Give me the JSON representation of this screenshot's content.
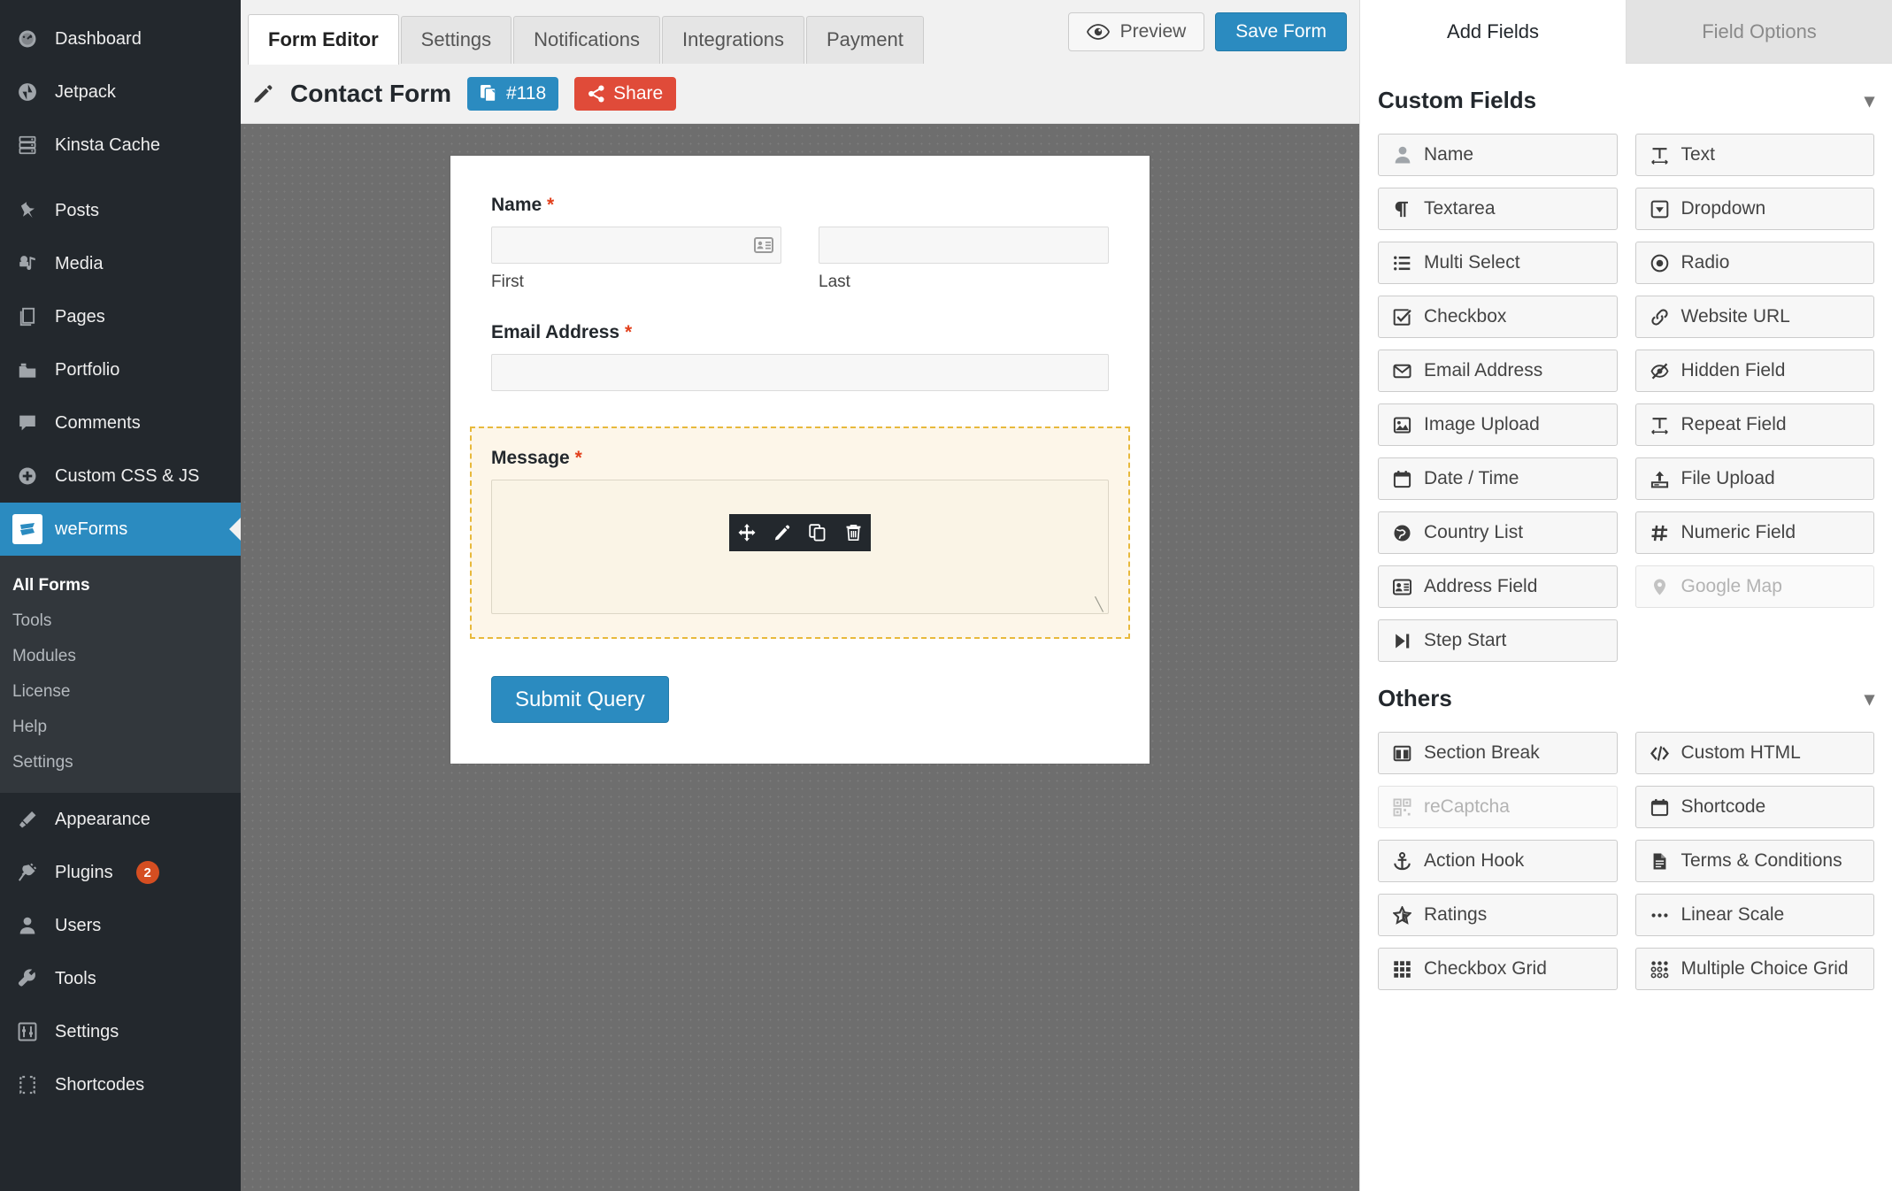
{
  "sidebar": {
    "items_top": [
      {
        "label": "Dashboard",
        "icon": "dashboard-icon"
      },
      {
        "label": "Jetpack",
        "icon": "jetpack-icon"
      },
      {
        "label": "Kinsta Cache",
        "icon": "server-icon"
      }
    ],
    "items_content": [
      {
        "label": "Posts",
        "icon": "pin-icon"
      },
      {
        "label": "Media",
        "icon": "media-icon"
      },
      {
        "label": "Pages",
        "icon": "pages-icon"
      },
      {
        "label": "Portfolio",
        "icon": "portfolio-icon"
      },
      {
        "label": "Comments",
        "icon": "comment-icon"
      },
      {
        "label": "Custom CSS & JS",
        "icon": "plus-circle-icon"
      }
    ],
    "active_item": {
      "label": "weForms",
      "icon": "weforms-logo-icon"
    },
    "submenu": [
      {
        "label": "All Forms",
        "current": true
      },
      {
        "label": "Tools",
        "current": false
      },
      {
        "label": "Modules",
        "current": false
      },
      {
        "label": "License",
        "current": false
      },
      {
        "label": "Help",
        "current": false
      },
      {
        "label": "Settings",
        "current": false
      }
    ],
    "items_bottom": [
      {
        "label": "Appearance",
        "icon": "brush-icon",
        "badge": ""
      },
      {
        "label": "Plugins",
        "icon": "plug-icon",
        "badge": "2"
      },
      {
        "label": "Users",
        "icon": "user-icon",
        "badge": ""
      },
      {
        "label": "Tools",
        "icon": "wrench-icon",
        "badge": ""
      },
      {
        "label": "Settings",
        "icon": "sliders-icon",
        "badge": ""
      },
      {
        "label": "Shortcodes",
        "icon": "brackets-icon",
        "badge": ""
      }
    ]
  },
  "tabs": [
    {
      "label": "Form Editor",
      "active": true
    },
    {
      "label": "Settings",
      "active": false
    },
    {
      "label": "Notifications",
      "active": false
    },
    {
      "label": "Integrations",
      "active": false
    },
    {
      "label": "Payment",
      "active": false
    }
  ],
  "top_actions": {
    "preview_label": "Preview",
    "save_label": "Save Form"
  },
  "title_row": {
    "form_name": "Contact Form",
    "form_id_label": "#118",
    "share_label": "Share"
  },
  "form": {
    "fields": [
      {
        "label": "Name",
        "required": "*",
        "type": "name",
        "columns": [
          {
            "sub_label": "First",
            "value": "",
            "has_autofill_icon": true
          },
          {
            "sub_label": "Last",
            "value": "",
            "has_autofill_icon": false
          }
        ]
      },
      {
        "label": "Email Address",
        "required": "*",
        "type": "email",
        "value": ""
      },
      {
        "label": "Message",
        "required": "*",
        "type": "textarea",
        "value": "",
        "highlighted": true
      }
    ],
    "submit_label": "Submit Query",
    "hover_toolbar": [
      {
        "name": "move-icon",
        "title": "Move"
      },
      {
        "name": "edit-icon",
        "title": "Edit"
      },
      {
        "name": "duplicate-icon",
        "title": "Duplicate"
      },
      {
        "name": "delete-icon",
        "title": "Delete"
      }
    ]
  },
  "right_panel": {
    "tabs": [
      {
        "label": "Add Fields",
        "active": true
      },
      {
        "label": "Field Options",
        "active": false
      }
    ],
    "sections": [
      {
        "title": "Custom Fields",
        "collapsed": false,
        "fields": [
          {
            "label": "Name",
            "icon": "user-icon",
            "disabled": false
          },
          {
            "label": "Text",
            "icon": "text-width-icon",
            "disabled": false
          },
          {
            "label": "Textarea",
            "icon": "paragraph-icon",
            "disabled": false
          },
          {
            "label": "Dropdown",
            "icon": "caret-square-down-icon",
            "disabled": false
          },
          {
            "label": "Multi Select",
            "icon": "list-ul-icon",
            "disabled": false
          },
          {
            "label": "Radio",
            "icon": "dot-circle-icon",
            "disabled": false
          },
          {
            "label": "Checkbox",
            "icon": "check-square-icon",
            "disabled": false
          },
          {
            "label": "Website URL",
            "icon": "link-icon",
            "disabled": false
          },
          {
            "label": "Email Address",
            "icon": "envelope-icon",
            "disabled": false
          },
          {
            "label": "Hidden Field",
            "icon": "eye-slash-icon",
            "disabled": false
          },
          {
            "label": "Image Upload",
            "icon": "image-icon",
            "disabled": false
          },
          {
            "label": "Repeat Field",
            "icon": "text-width-icon",
            "disabled": false
          },
          {
            "label": "Date / Time",
            "icon": "calendar-icon",
            "disabled": false
          },
          {
            "label": "File Upload",
            "icon": "upload-icon",
            "disabled": false
          },
          {
            "label": "Country List",
            "icon": "globe-icon",
            "disabled": false
          },
          {
            "label": "Numeric Field",
            "icon": "hashtag-icon",
            "disabled": false
          },
          {
            "label": "Address Field",
            "icon": "address-card-icon",
            "disabled": false
          },
          {
            "label": "Google Map",
            "icon": "map-marker-icon",
            "disabled": true
          },
          {
            "label": "Step Start",
            "icon": "step-forward-icon",
            "disabled": false
          }
        ]
      },
      {
        "title": "Others",
        "collapsed": false,
        "fields": [
          {
            "label": "Section Break",
            "icon": "columns-icon",
            "disabled": false
          },
          {
            "label": "Custom HTML",
            "icon": "code-icon",
            "disabled": false
          },
          {
            "label": "reCaptcha",
            "icon": "qrcode-icon",
            "disabled": true
          },
          {
            "label": "Shortcode",
            "icon": "calendar-alt-icon",
            "disabled": false
          },
          {
            "label": "Action Hook",
            "icon": "anchor-icon",
            "disabled": false
          },
          {
            "label": "Terms & Conditions",
            "icon": "file-text-icon",
            "disabled": false
          },
          {
            "label": "Ratings",
            "icon": "star-icon",
            "disabled": false
          },
          {
            "label": "Linear Scale",
            "icon": "ellipsis-icon",
            "disabled": false
          },
          {
            "label": "Checkbox Grid",
            "icon": "grid-filled-icon",
            "disabled": false
          },
          {
            "label": "Multiple Choice Grid",
            "icon": "grid-circles-icon",
            "disabled": false
          }
        ]
      }
    ]
  },
  "colors": {
    "wp_sidebar": "#23282d",
    "wp_submenu": "#32373c",
    "accent_blue": "#2b8bc0",
    "share_red": "#e04b39",
    "badge_orange": "#d54e21",
    "required_red": "#e2401c",
    "highlight_bg": "#fdf6e9",
    "highlight_border": "#e8b93c",
    "canvas_gray": "#6e6e6e"
  }
}
